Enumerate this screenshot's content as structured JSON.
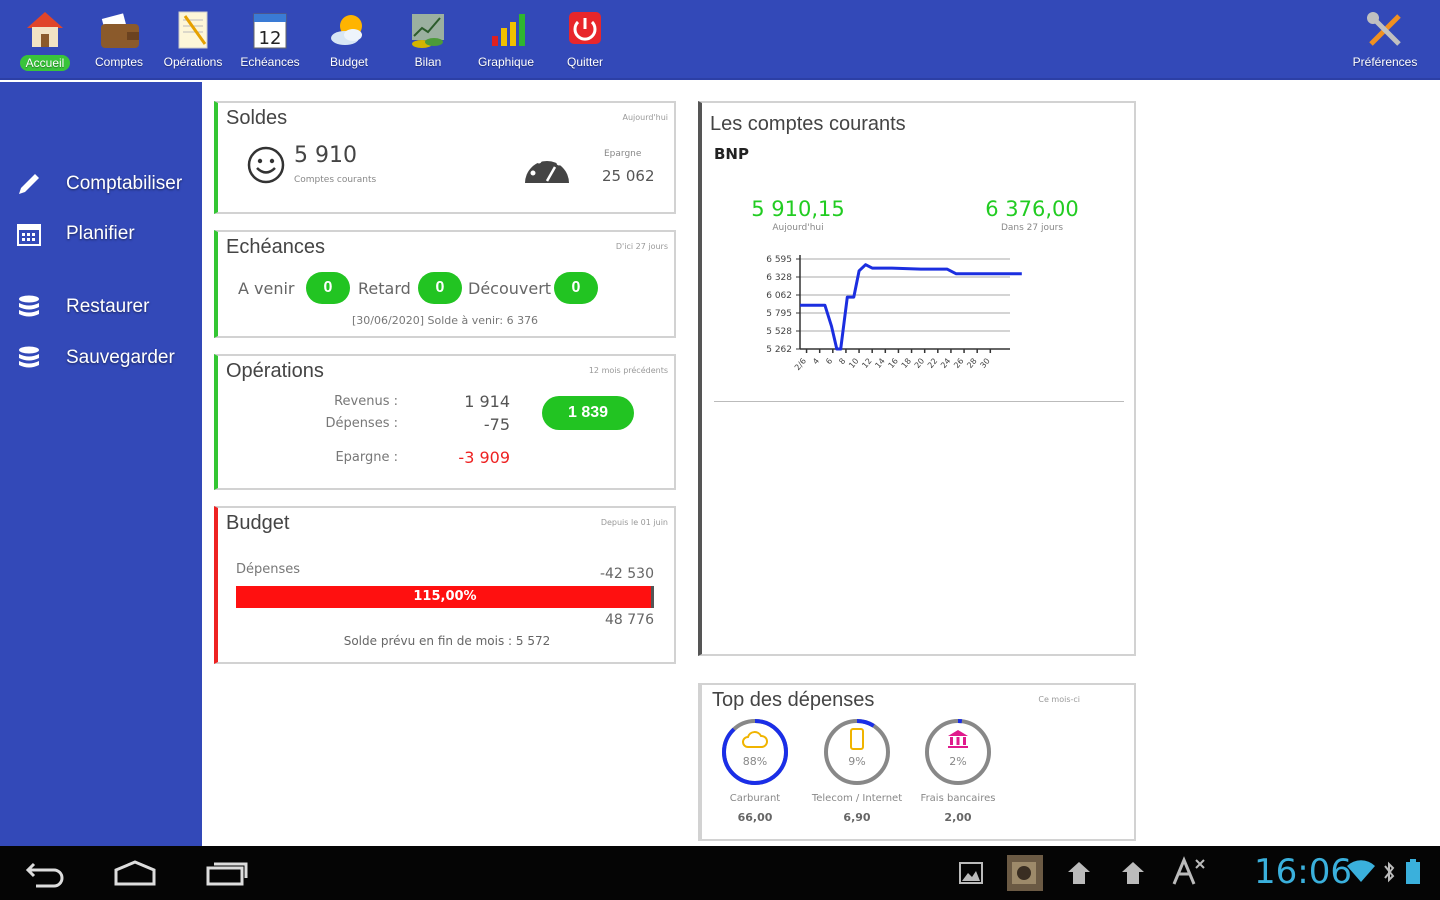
{
  "toolbar": {
    "items": [
      {
        "label": "Accueil",
        "icon": "home-icon"
      },
      {
        "label": "Comptes",
        "icon": "wallet-icon"
      },
      {
        "label": "Opérations",
        "icon": "notepad-icon"
      },
      {
        "label": "Echéances",
        "icon": "calendar-icon"
      },
      {
        "label": "Budget",
        "icon": "weather-icon"
      },
      {
        "label": "Bilan",
        "icon": "money-icon"
      },
      {
        "label": "Graphique",
        "icon": "bar-chart-icon"
      },
      {
        "label": "Quitter",
        "icon": "power-icon"
      }
    ],
    "preferences_label": "Préférences"
  },
  "sidebar": {
    "items": [
      {
        "label": "Comptabiliser",
        "icon": "pencil-icon"
      },
      {
        "label": "Planifier",
        "icon": "calendar-icon"
      },
      {
        "label": "Restaurer",
        "icon": "database-icon"
      },
      {
        "label": "Sauvegarder",
        "icon": "database-icon"
      }
    ]
  },
  "soldes": {
    "title": "Soldes",
    "hint": "Aujourd'hui",
    "amount": "5 910",
    "amount_caption": "Comptes courants",
    "epargne_label": "Epargne",
    "epargne_amount": "25 062"
  },
  "echeances": {
    "title": "Echéances",
    "hint": "D'ici 27 jours",
    "a_venir_label": "A venir",
    "a_venir_count": "0",
    "retard_label": "Retard",
    "retard_count": "0",
    "decouvert_label": "Découvert",
    "decouvert_count": "0",
    "footer": "[30/06/2020]  Solde à venir: 6 376"
  },
  "operations": {
    "title": "Opérations",
    "hint": "12 mois précédents",
    "revenus_label": "Revenus :",
    "revenus_value": "1 914",
    "depenses_label": "Dépenses :",
    "depenses_value": "-75",
    "epargne_label": "Epargne :",
    "epargne_value": "-3 909",
    "total": "1 839"
  },
  "budget": {
    "title": "Budget",
    "hint": "Depuis le 01 juin",
    "depenses_label": "Dépenses",
    "spent": "-42 530",
    "percent_label": "115,00%",
    "progress": 1.0,
    "limit": "48 776",
    "footer": "Solde prévu en fin de mois : 5 572"
  },
  "comptes": {
    "title": "Les comptes courants",
    "bank": "BNP",
    "today_value": "5 910,15",
    "today_caption": "Aujourd'hui",
    "future_value": "6 376,00",
    "future_caption": "Dans 27 jours"
  },
  "chart_data": {
    "type": "line",
    "yticks": [
      "6 595",
      "6 328",
      "6 062",
      "5 795",
      "5 528",
      "5 262"
    ],
    "xticks": [
      "2/6",
      "4",
      "6",
      "8",
      "10",
      "12",
      "14",
      "16",
      "18",
      "20",
      "22",
      "24",
      "26",
      "28",
      "30"
    ],
    "ylim": [
      5262,
      6595
    ],
    "x": [
      0,
      1.9,
      2.4,
      2.8,
      3.1,
      3.6,
      4.1,
      4.5,
      5.0,
      5.5,
      6.0,
      7.0,
      9.2,
      11.2,
      11.9,
      14.0,
      16.9
    ],
    "values": [
      5910,
      5910,
      5600,
      5262,
      5262,
      6030,
      6030,
      6420,
      6510,
      6460,
      6460,
      6460,
      6445,
      6445,
      6376,
      6376,
      6376
    ],
    "series_color": "#1b2ee0",
    "grid": true
  },
  "top_depenses": {
    "title": "Top des dépenses",
    "hint": "Ce mois-ci",
    "items": [
      {
        "percent_label": "88%",
        "percent": 0.88,
        "label": "Carburant",
        "amount": "66,00",
        "icon": "cloud-icon",
        "color": "#f0b400"
      },
      {
        "percent_label": "9%",
        "percent": 0.09,
        "label": "Telecom / Internet",
        "amount": "6,90",
        "icon": "phone-icon",
        "color": "#f0b400"
      },
      {
        "percent_label": "2%",
        "percent": 0.02,
        "label": "Frais bancaires",
        "amount": "2,00",
        "icon": "bank-icon",
        "color": "#e01a8c"
      }
    ]
  },
  "status": {
    "clock": "16:06"
  }
}
